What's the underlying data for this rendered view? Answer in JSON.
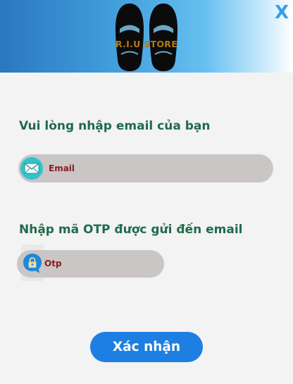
{
  "header": {
    "brand": "R.I.U STORE",
    "close_label": "X",
    "colors": {
      "gradient_start": "#2a78bf",
      "gradient_end": "#ffffff",
      "brand_text": "#b07a14",
      "close": "#3a9ee6"
    }
  },
  "form": {
    "email_label": "Vui lòng nhập email của bạn",
    "email_placeholder": "Email",
    "email_icon": "mail-icon",
    "otp_label": "Nhập mã OTP được gửi đến email",
    "otp_placeholder": "Otp",
    "otp_icon": "lock-chat-icon",
    "submit_label": "Xác nhận",
    "colors": {
      "label": "#1f6b4c",
      "field_bg": "#cbc6c6",
      "placeholder": "#8b1a1a",
      "button": "#1d7fe1"
    }
  }
}
